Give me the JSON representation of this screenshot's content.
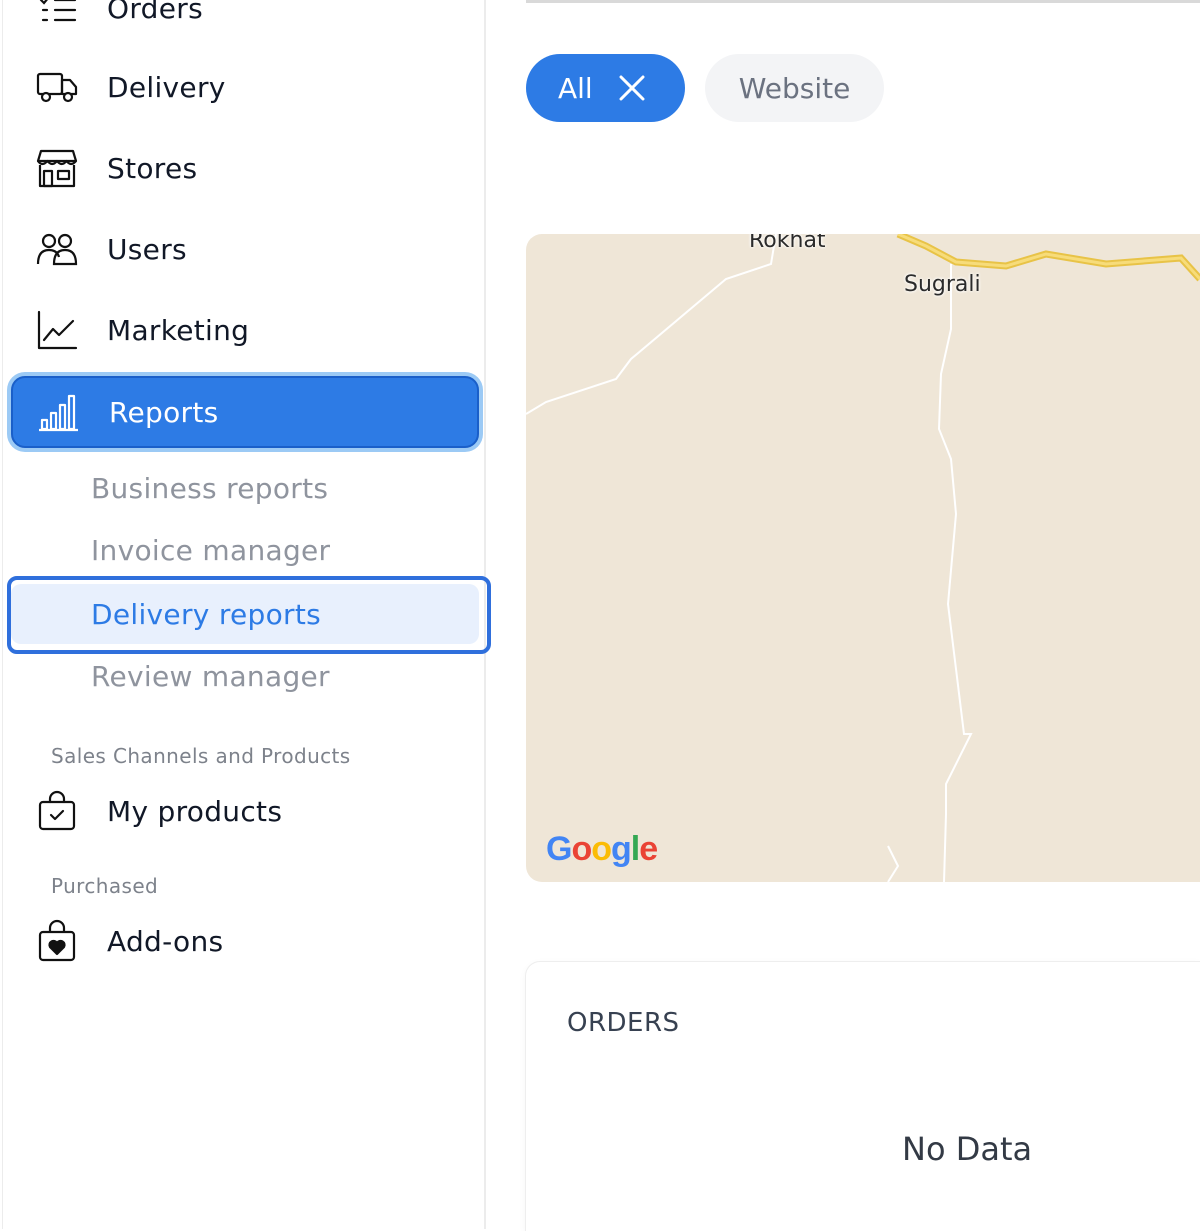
{
  "sidebar": {
    "items": [
      {
        "label": "Orders",
        "icon": "list-icon"
      },
      {
        "label": "Delivery",
        "icon": "truck-icon"
      },
      {
        "label": "Stores",
        "icon": "store-icon"
      },
      {
        "label": "Users",
        "icon": "users-icon"
      },
      {
        "label": "Marketing",
        "icon": "line-chart-icon"
      },
      {
        "label": "Reports",
        "icon": "bar-chart-icon"
      }
    ],
    "report_subitems": [
      {
        "label": "Business reports"
      },
      {
        "label": "Invoice manager"
      },
      {
        "label": "Delivery reports"
      },
      {
        "label": "Review manager"
      }
    ],
    "sales_section_label": "Sales Channels and Products",
    "my_products_label": "My products",
    "purchased_section_label": "Purchased",
    "addons_label": "Add-ons",
    "active_color": "#2d7be5"
  },
  "filters": {
    "chips": [
      {
        "label": "All",
        "selected": true
      },
      {
        "label": "Website",
        "selected": false
      }
    ]
  },
  "map": {
    "places": [
      "Rokhat",
      "Sugrali"
    ],
    "logo_text": "Google"
  },
  "orders_card": {
    "title": "ORDERS",
    "empty_text": "No Data"
  }
}
